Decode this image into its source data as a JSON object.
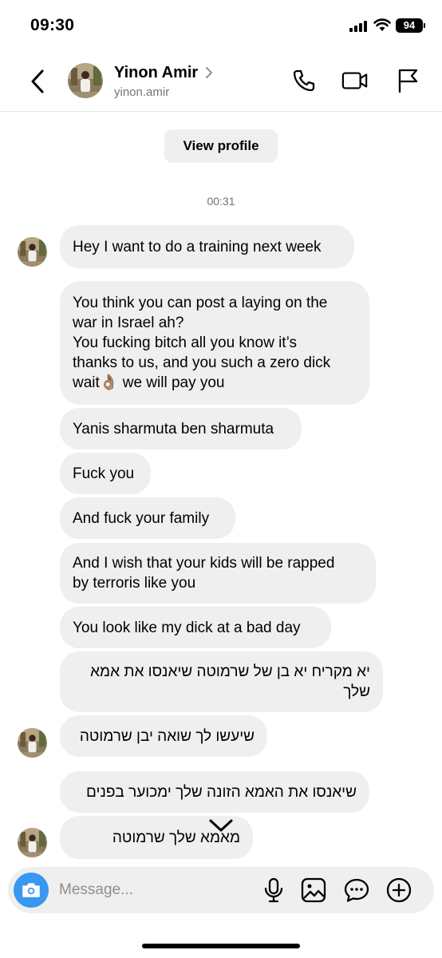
{
  "status_bar": {
    "time": "09:30",
    "battery": "94"
  },
  "header": {
    "contact_name": "Yinon Amir",
    "username": "yinon.amir"
  },
  "view_profile_label": "View profile",
  "timestamp": "00:31",
  "messages": [
    {
      "lines": [
        "Hey I want to do a training next week"
      ]
    },
    {
      "lines": [
        "You think you can post a laying on the",
        "war in Israel ah?",
        "You fucking bitch all you know it’s",
        "thanks to us, and you such a zero dick",
        "wait👌🏽 we will pay you"
      ]
    },
    {
      "lines": [
        "Yanis sharmuta ben sharmuta"
      ]
    },
    {
      "lines": [
        "Fuck you"
      ]
    },
    {
      "lines": [
        "And fuck your family"
      ]
    },
    {
      "lines": [
        "And I wish that your kids will be rapped",
        "by terroris like you"
      ]
    },
    {
      "lines": [
        "You look like my dick at a bad day"
      ]
    },
    {
      "lines": [
        "יא מקריח יא בן של שרמוטה שיאנסו את אמא",
        "שלך"
      ]
    },
    {
      "lines": [
        "שיעשו לך שואה יבן שרמוטה"
      ]
    },
    {
      "lines": [
        "שיאנסו את האמא הזונה שלך ימכוער בפנים"
      ]
    },
    {
      "lines": [
        "מאמא שלך שרמוטה"
      ]
    }
  ],
  "composer": {
    "placeholder": "Message..."
  },
  "colors": {
    "bubble": "#efefef",
    "accent": "#3897f0",
    "secondary_text": "#737373"
  },
  "icons": [
    "back-chevron-icon",
    "phone-icon",
    "video-camera-icon",
    "flag-icon",
    "camera-icon",
    "microphone-icon",
    "gallery-icon",
    "sticker-icon",
    "plus-icon",
    "chevron-down-icon"
  ]
}
